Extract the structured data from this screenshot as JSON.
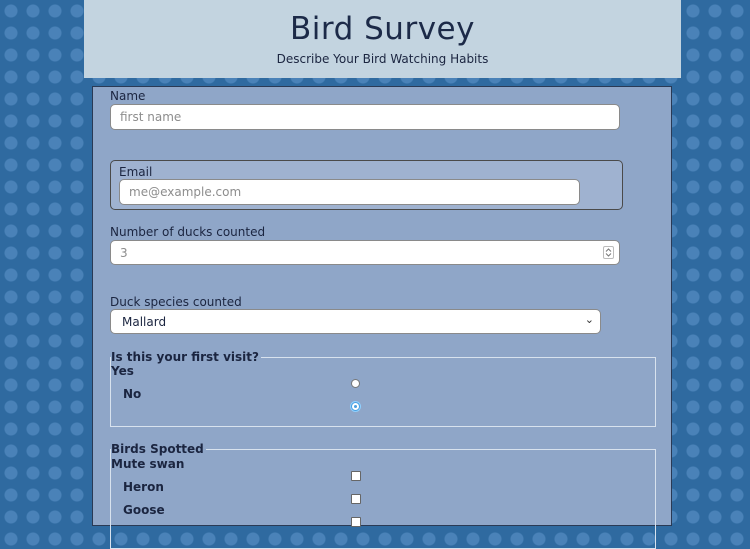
{
  "header": {
    "title": "Bird Survey",
    "subtitle": "Describe Your Bird Watching Habits"
  },
  "form": {
    "name": {
      "label": "Name",
      "placeholder": "first name"
    },
    "email": {
      "label": "Email",
      "placeholder": "me@example.com"
    },
    "ducks": {
      "label": "Number of ducks counted",
      "value": "3"
    },
    "species": {
      "label": "Duck species counted",
      "selected": "Mallard",
      "caret": "⌄"
    },
    "first_visit": {
      "legend": "Is this your first visit?",
      "options": [
        {
          "label": "Yes",
          "checked": false
        },
        {
          "label": "No",
          "checked": true
        }
      ]
    },
    "birds": {
      "legend": "Birds Spotted",
      "options": [
        {
          "label": "Mute swan",
          "checked": false
        },
        {
          "label": "Heron",
          "checked": false
        },
        {
          "label": "Goose",
          "checked": false
        }
      ]
    }
  }
}
